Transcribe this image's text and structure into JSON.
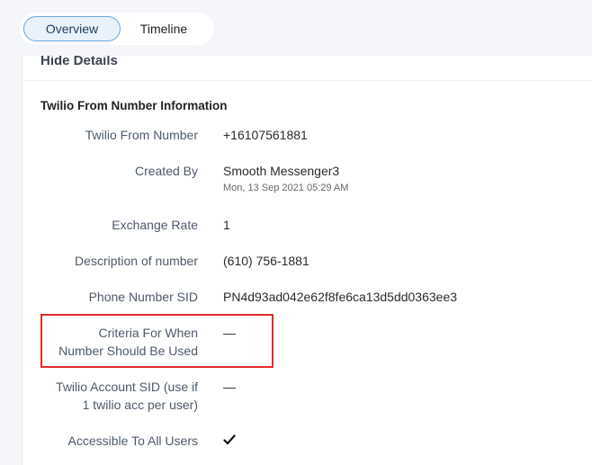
{
  "tabs": [
    {
      "label": "Overview",
      "active": true
    },
    {
      "label": "Timeline",
      "active": false
    }
  ],
  "hide_details_label": "Hide Details",
  "section_title": "Twilio From Number Information",
  "fields": {
    "twilio_from_number": {
      "label": "Twilio From Number",
      "value": "+16107561881"
    },
    "created_by": {
      "label": "Created By",
      "value": "Smooth Messenger3",
      "timestamp": "Mon, 13 Sep 2021 05:29 AM"
    },
    "exchange_rate": {
      "label": "Exchange Rate",
      "value": "1"
    },
    "description": {
      "label": "Description of number",
      "value": "(610) 756-1881"
    },
    "phone_sid": {
      "label": "Phone Number SID",
      "value": "PN4d93ad042e62f8fe6ca13d5dd0363ee3"
    },
    "criteria": {
      "label_line1": "Criteria For When",
      "label_line2": "Number Should Be Used",
      "value": "—"
    },
    "account_sid": {
      "label_line1": "Twilio Account SID (use if",
      "label_line2": "1 twilio acc per user)",
      "value": "—"
    },
    "accessible": {
      "label": "Accessible To All Users",
      "value_icon": "checkmark-icon"
    }
  },
  "colors": {
    "highlight": "#e32b2b",
    "tab_active_border": "#6aa7dc"
  }
}
